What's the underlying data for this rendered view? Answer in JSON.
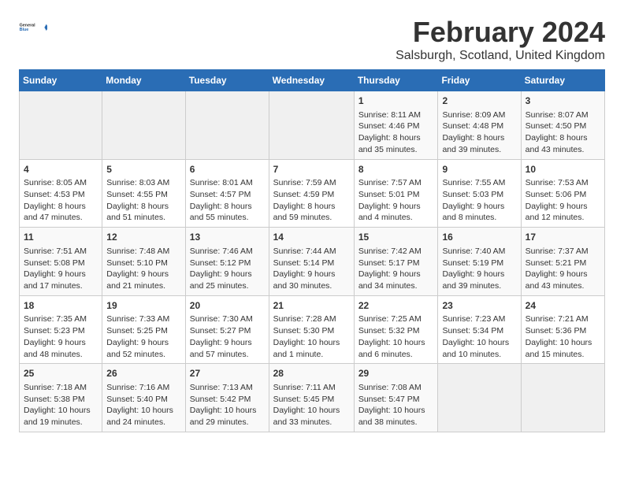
{
  "logo": {
    "general": "General",
    "blue": "Blue"
  },
  "title": "February 2024",
  "subtitle": "Salsburgh, Scotland, United Kingdom",
  "days_of_week": [
    "Sunday",
    "Monday",
    "Tuesday",
    "Wednesday",
    "Thursday",
    "Friday",
    "Saturday"
  ],
  "weeks": [
    [
      {
        "day": "",
        "content": ""
      },
      {
        "day": "",
        "content": ""
      },
      {
        "day": "",
        "content": ""
      },
      {
        "day": "",
        "content": ""
      },
      {
        "day": "1",
        "content": "Sunrise: 8:11 AM\nSunset: 4:46 PM\nDaylight: 8 hours\nand 35 minutes."
      },
      {
        "day": "2",
        "content": "Sunrise: 8:09 AM\nSunset: 4:48 PM\nDaylight: 8 hours\nand 39 minutes."
      },
      {
        "day": "3",
        "content": "Sunrise: 8:07 AM\nSunset: 4:50 PM\nDaylight: 8 hours\nand 43 minutes."
      }
    ],
    [
      {
        "day": "4",
        "content": "Sunrise: 8:05 AM\nSunset: 4:53 PM\nDaylight: 8 hours\nand 47 minutes."
      },
      {
        "day": "5",
        "content": "Sunrise: 8:03 AM\nSunset: 4:55 PM\nDaylight: 8 hours\nand 51 minutes."
      },
      {
        "day": "6",
        "content": "Sunrise: 8:01 AM\nSunset: 4:57 PM\nDaylight: 8 hours\nand 55 minutes."
      },
      {
        "day": "7",
        "content": "Sunrise: 7:59 AM\nSunset: 4:59 PM\nDaylight: 8 hours\nand 59 minutes."
      },
      {
        "day": "8",
        "content": "Sunrise: 7:57 AM\nSunset: 5:01 PM\nDaylight: 9 hours\nand 4 minutes."
      },
      {
        "day": "9",
        "content": "Sunrise: 7:55 AM\nSunset: 5:03 PM\nDaylight: 9 hours\nand 8 minutes."
      },
      {
        "day": "10",
        "content": "Sunrise: 7:53 AM\nSunset: 5:06 PM\nDaylight: 9 hours\nand 12 minutes."
      }
    ],
    [
      {
        "day": "11",
        "content": "Sunrise: 7:51 AM\nSunset: 5:08 PM\nDaylight: 9 hours\nand 17 minutes."
      },
      {
        "day": "12",
        "content": "Sunrise: 7:48 AM\nSunset: 5:10 PM\nDaylight: 9 hours\nand 21 minutes."
      },
      {
        "day": "13",
        "content": "Sunrise: 7:46 AM\nSunset: 5:12 PM\nDaylight: 9 hours\nand 25 minutes."
      },
      {
        "day": "14",
        "content": "Sunrise: 7:44 AM\nSunset: 5:14 PM\nDaylight: 9 hours\nand 30 minutes."
      },
      {
        "day": "15",
        "content": "Sunrise: 7:42 AM\nSunset: 5:17 PM\nDaylight: 9 hours\nand 34 minutes."
      },
      {
        "day": "16",
        "content": "Sunrise: 7:40 AM\nSunset: 5:19 PM\nDaylight: 9 hours\nand 39 minutes."
      },
      {
        "day": "17",
        "content": "Sunrise: 7:37 AM\nSunset: 5:21 PM\nDaylight: 9 hours\nand 43 minutes."
      }
    ],
    [
      {
        "day": "18",
        "content": "Sunrise: 7:35 AM\nSunset: 5:23 PM\nDaylight: 9 hours\nand 48 minutes."
      },
      {
        "day": "19",
        "content": "Sunrise: 7:33 AM\nSunset: 5:25 PM\nDaylight: 9 hours\nand 52 minutes."
      },
      {
        "day": "20",
        "content": "Sunrise: 7:30 AM\nSunset: 5:27 PM\nDaylight: 9 hours\nand 57 minutes."
      },
      {
        "day": "21",
        "content": "Sunrise: 7:28 AM\nSunset: 5:30 PM\nDaylight: 10 hours\nand 1 minute."
      },
      {
        "day": "22",
        "content": "Sunrise: 7:25 AM\nSunset: 5:32 PM\nDaylight: 10 hours\nand 6 minutes."
      },
      {
        "day": "23",
        "content": "Sunrise: 7:23 AM\nSunset: 5:34 PM\nDaylight: 10 hours\nand 10 minutes."
      },
      {
        "day": "24",
        "content": "Sunrise: 7:21 AM\nSunset: 5:36 PM\nDaylight: 10 hours\nand 15 minutes."
      }
    ],
    [
      {
        "day": "25",
        "content": "Sunrise: 7:18 AM\nSunset: 5:38 PM\nDaylight: 10 hours\nand 19 minutes."
      },
      {
        "day": "26",
        "content": "Sunrise: 7:16 AM\nSunset: 5:40 PM\nDaylight: 10 hours\nand 24 minutes."
      },
      {
        "day": "27",
        "content": "Sunrise: 7:13 AM\nSunset: 5:42 PM\nDaylight: 10 hours\nand 29 minutes."
      },
      {
        "day": "28",
        "content": "Sunrise: 7:11 AM\nSunset: 5:45 PM\nDaylight: 10 hours\nand 33 minutes."
      },
      {
        "day": "29",
        "content": "Sunrise: 7:08 AM\nSunset: 5:47 PM\nDaylight: 10 hours\nand 38 minutes."
      },
      {
        "day": "",
        "content": ""
      },
      {
        "day": "",
        "content": ""
      }
    ]
  ]
}
